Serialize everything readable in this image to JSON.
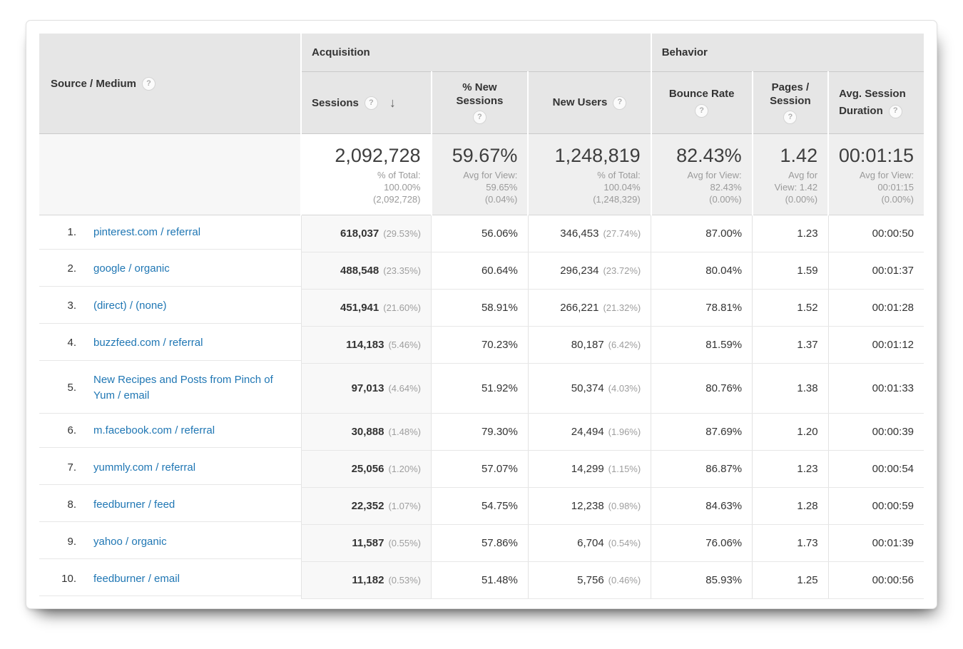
{
  "icons": {
    "help": "?",
    "sort_desc": "↓"
  },
  "table": {
    "source_header": "Source / Medium",
    "groups": [
      "Acquisition",
      "Behavior"
    ],
    "columns": {
      "sessions": "Sessions",
      "new_sessions_l1": "% New",
      "new_sessions_l2": "Sessions",
      "new_users": "New Users",
      "bounce": "Bounce Rate",
      "pages_l1": "Pages /",
      "pages_l2": "Session",
      "duration_l1": "Avg. Session",
      "duration_l2": "Duration"
    },
    "summary": {
      "sessions": "2,092,728",
      "sessions_sub": "% of Total:\n100.00%\n(2,092,728)",
      "new_sessions": "59.67%",
      "new_sessions_sub": "Avg for View:\n59.65%\n(0.04%)",
      "new_users": "1,248,819",
      "new_users_sub": "% of Total:\n100.04%\n(1,248,329)",
      "bounce": "82.43%",
      "bounce_sub": "Avg for View:\n82.43%\n(0.00%)",
      "pages": "1.42",
      "pages_sub": "Avg for\nView: 1.42\n(0.00%)",
      "duration": "00:01:15",
      "duration_sub": "Avg for View:\n00:01:15\n(0.00%)"
    },
    "rows": [
      {
        "rank": "1.",
        "source": "pinterest.com / referral",
        "sessions": "618,037",
        "sessions_pct": "(29.53%)",
        "new_sessions": "56.06%",
        "new_users": "346,453",
        "new_users_pct": "(27.74%)",
        "bounce": "87.00%",
        "pages": "1.23",
        "duration": "00:00:50"
      },
      {
        "rank": "2.",
        "source": "google / organic",
        "sessions": "488,548",
        "sessions_pct": "(23.35%)",
        "new_sessions": "60.64%",
        "new_users": "296,234",
        "new_users_pct": "(23.72%)",
        "bounce": "80.04%",
        "pages": "1.59",
        "duration": "00:01:37"
      },
      {
        "rank": "3.",
        "source": "(direct) / (none)",
        "sessions": "451,941",
        "sessions_pct": "(21.60%)",
        "new_sessions": "58.91%",
        "new_users": "266,221",
        "new_users_pct": "(21.32%)",
        "bounce": "78.81%",
        "pages": "1.52",
        "duration": "00:01:28"
      },
      {
        "rank": "4.",
        "source": "buzzfeed.com / referral",
        "sessions": "114,183",
        "sessions_pct": "(5.46%)",
        "new_sessions": "70.23%",
        "new_users": "80,187",
        "new_users_pct": "(6.42%)",
        "bounce": "81.59%",
        "pages": "1.37",
        "duration": "00:01:12"
      },
      {
        "rank": "5.",
        "source": "New Recipes and Posts from Pinch of Yum / email",
        "sessions": "97,013",
        "sessions_pct": "(4.64%)",
        "new_sessions": "51.92%",
        "new_users": "50,374",
        "new_users_pct": "(4.03%)",
        "bounce": "80.76%",
        "pages": "1.38",
        "duration": "00:01:33"
      },
      {
        "rank": "6.",
        "source": "m.facebook.com / referral",
        "sessions": "30,888",
        "sessions_pct": "(1.48%)",
        "new_sessions": "79.30%",
        "new_users": "24,494",
        "new_users_pct": "(1.96%)",
        "bounce": "87.69%",
        "pages": "1.20",
        "duration": "00:00:39"
      },
      {
        "rank": "7.",
        "source": "yummly.com / referral",
        "sessions": "25,056",
        "sessions_pct": "(1.20%)",
        "new_sessions": "57.07%",
        "new_users": "14,299",
        "new_users_pct": "(1.15%)",
        "bounce": "86.87%",
        "pages": "1.23",
        "duration": "00:00:54"
      },
      {
        "rank": "8.",
        "source": "feedburner / feed",
        "sessions": "22,352",
        "sessions_pct": "(1.07%)",
        "new_sessions": "54.75%",
        "new_users": "12,238",
        "new_users_pct": "(0.98%)",
        "bounce": "84.63%",
        "pages": "1.28",
        "duration": "00:00:59"
      },
      {
        "rank": "9.",
        "source": "yahoo / organic",
        "sessions": "11,587",
        "sessions_pct": "(0.55%)",
        "new_sessions": "57.86%",
        "new_users": "6,704",
        "new_users_pct": "(0.54%)",
        "bounce": "76.06%",
        "pages": "1.73",
        "duration": "00:01:39"
      },
      {
        "rank": "10.",
        "source": "feedburner / email",
        "sessions": "11,182",
        "sessions_pct": "(0.53%)",
        "new_sessions": "51.48%",
        "new_users": "5,756",
        "new_users_pct": "(0.46%)",
        "bounce": "85.93%",
        "pages": "1.25",
        "duration": "00:00:56"
      }
    ]
  }
}
